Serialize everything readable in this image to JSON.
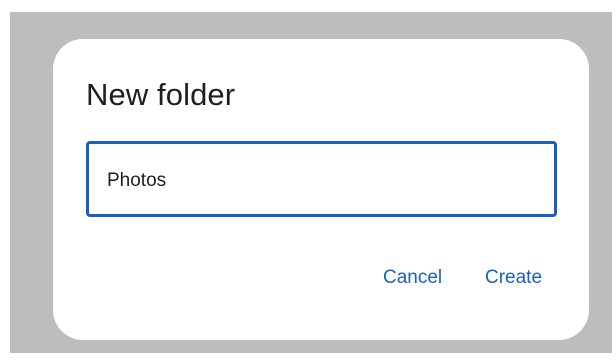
{
  "dialog": {
    "title": "New folder",
    "input": {
      "value": "Photos",
      "placeholder": ""
    },
    "buttons": {
      "cancel_label": "Cancel",
      "create_label": "Create"
    }
  },
  "colors": {
    "scrim": "#bdbdbd",
    "surface": "#ffffff",
    "accent": "#1a5fbf",
    "text": "#1f1f1f"
  }
}
